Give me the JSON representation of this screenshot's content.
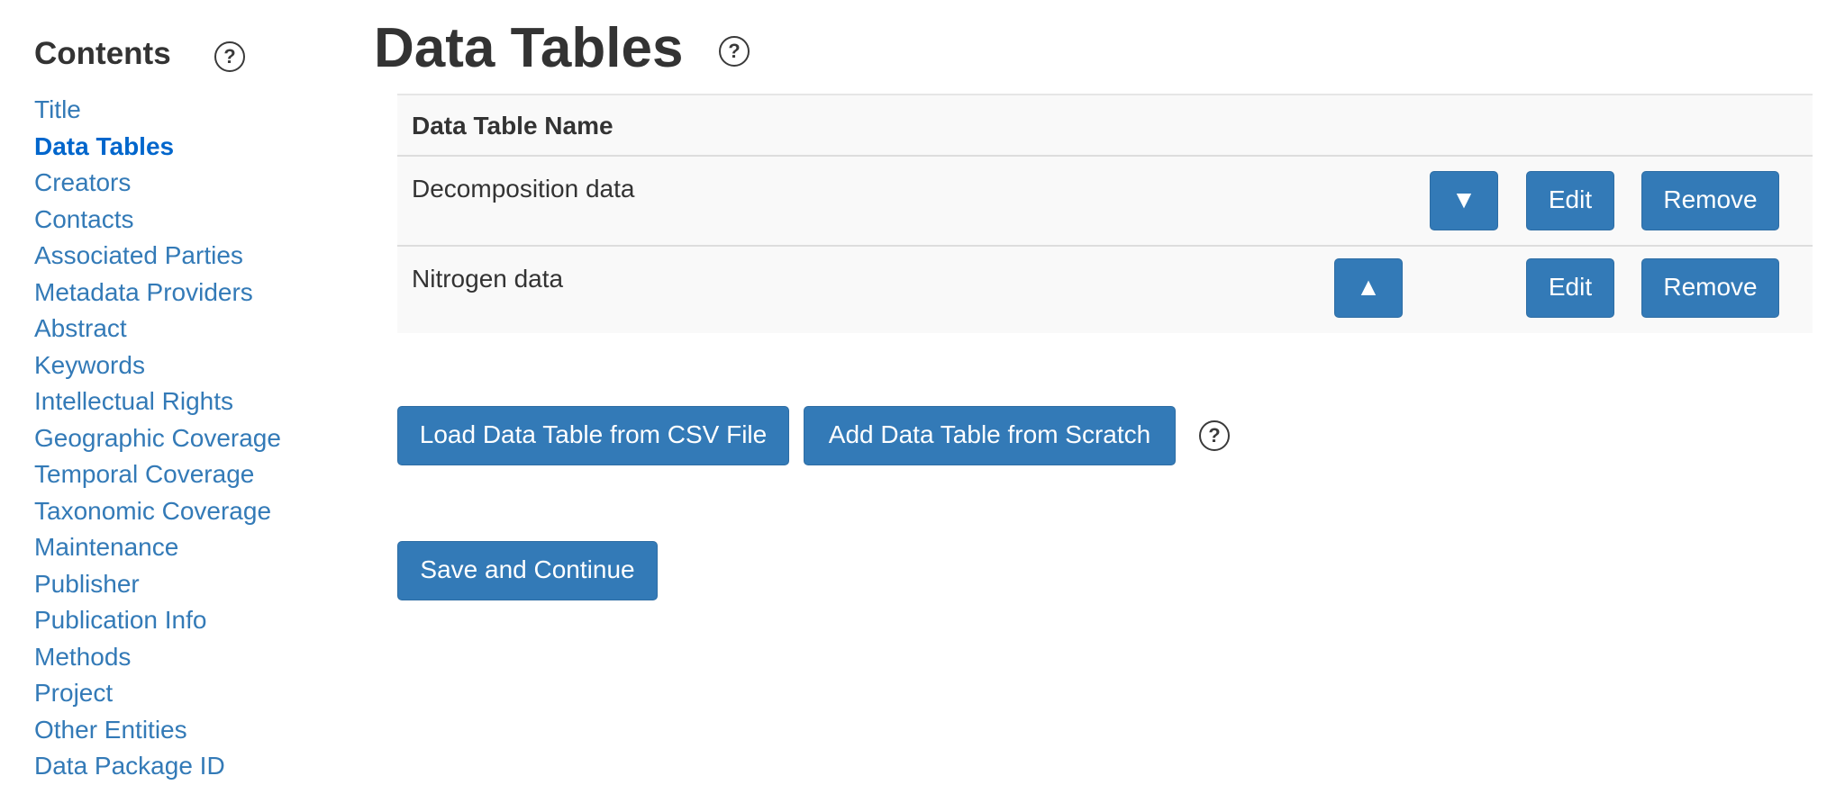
{
  "sidebar": {
    "title": "Contents",
    "items": [
      {
        "label": "Title"
      },
      {
        "label": "Data Tables"
      },
      {
        "label": "Creators"
      },
      {
        "label": "Contacts"
      },
      {
        "label": "Associated Parties"
      },
      {
        "label": "Metadata Providers"
      },
      {
        "label": "Abstract"
      },
      {
        "label": "Keywords"
      },
      {
        "label": "Intellectual Rights"
      },
      {
        "label": "Geographic Coverage"
      },
      {
        "label": "Temporal Coverage"
      },
      {
        "label": "Taxonomic Coverage"
      },
      {
        "label": "Maintenance"
      },
      {
        "label": "Publisher"
      },
      {
        "label": "Publication Info"
      },
      {
        "label": "Methods"
      },
      {
        "label": "Project"
      },
      {
        "label": "Other Entities"
      },
      {
        "label": "Data Package ID"
      }
    ],
    "active_item": "Data Tables"
  },
  "help_glyph": "?",
  "main": {
    "title": "Data Tables",
    "table": {
      "header": "Data Table Name",
      "rows": [
        {
          "name": "Decomposition data",
          "move_glyph": "▼",
          "edit_label": "Edit",
          "remove_label": "Remove"
        },
        {
          "name": "Nitrogen data",
          "move_glyph": "▲",
          "edit_label": "Edit",
          "remove_label": "Remove"
        }
      ]
    },
    "load_button": "Load Data Table from CSV File",
    "add_button": "Add Data Table from Scratch",
    "save_button": "Save and Continue"
  },
  "colors": {
    "link": "#337ab7",
    "active_link": "#0066cc",
    "button_bg": "#337ab7",
    "table_stripe": "#f9f9f9"
  },
  "icons": {
    "help": "question-circle-icon",
    "move_down": "triangle-down-icon",
    "move_up": "triangle-up-icon"
  }
}
